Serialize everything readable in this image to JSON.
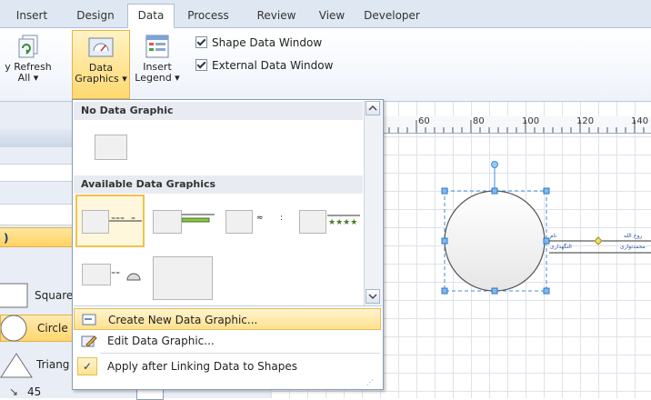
{
  "tabs": [
    {
      "label": "Insert"
    },
    {
      "label": "Design"
    },
    {
      "label": "Data"
    },
    {
      "label": "Process"
    },
    {
      "label": "Review"
    },
    {
      "label": "View"
    },
    {
      "label": "Developer"
    }
  ],
  "ribbon": {
    "refresh_label_line1": "y Refresh",
    "refresh_label_line2": "All ▾",
    "data_graphics_line1": "Data",
    "data_graphics_line2": "Graphics ▾",
    "insert_legend_line1": "Insert",
    "insert_legend_line2": "Legend ▾",
    "shape_data_window": "Shape Data Window",
    "external_data_window": "External Data Window"
  },
  "shapes": [
    {
      "label": "Square"
    },
    {
      "label": "Circle"
    },
    {
      "label": "Triang"
    },
    {
      "label": "45 degree"
    }
  ],
  "ruler_ticks": [
    "60",
    "80",
    "100",
    "120",
    "140"
  ],
  "dropdown": {
    "section_none": "No Data Graphic",
    "section_available": "Available Data Graphics",
    "menu": {
      "create": "Create New Data Graphic...",
      "edit": "Edit Data Graphic...",
      "apply": "Apply after Linking Data to Shapes"
    }
  },
  "canvas": {
    "callout_row1_left": "نام",
    "callout_row1_right": "روح الله",
    "callout_row2_left": "النگهداری",
    "callout_row2_right": "محمدتواری"
  },
  "colors": {
    "ribbon_bg": "#dfe7f2",
    "highlight": "#ffd970",
    "selection_handle": "#3d8ee0"
  }
}
